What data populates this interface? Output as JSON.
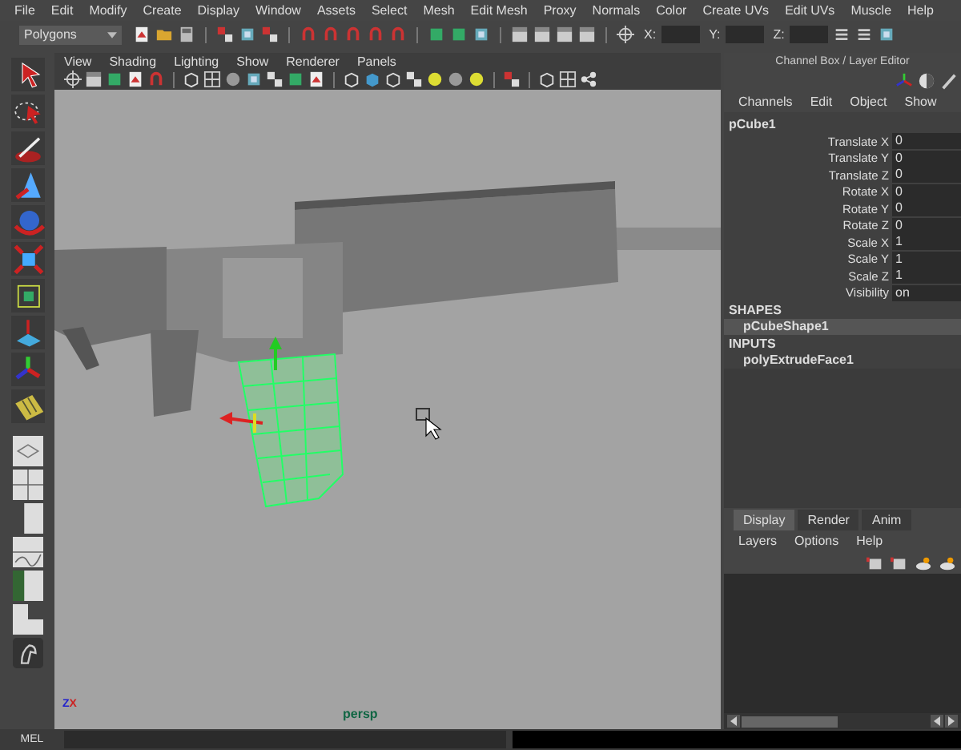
{
  "menu_bar": [
    "File",
    "Edit",
    "Modify",
    "Create",
    "Display",
    "Window",
    "Assets",
    "Select",
    "Mesh",
    "Edit Mesh",
    "Proxy",
    "Normals",
    "Color",
    "Create UVs",
    "Edit UVs",
    "Muscle",
    "Help"
  ],
  "status_line": {
    "menu_set": "Polygons",
    "fields": [
      {
        "label": "X:"
      },
      {
        "label": "Y:"
      },
      {
        "label": "Z:"
      }
    ]
  },
  "viewport": {
    "menu": [
      "View",
      "Shading",
      "Lighting",
      "Show",
      "Renderer",
      "Panels"
    ],
    "camera": "persp",
    "axis_labels": [
      "Z",
      "X"
    ]
  },
  "channel_box": {
    "title": "Channel Box / Layer Editor",
    "menu": [
      "Channels",
      "Edit",
      "Object",
      "Show"
    ],
    "object": "pCube1",
    "attributes": [
      {
        "label": "Translate X",
        "value": "0"
      },
      {
        "label": "Translate Y",
        "value": "0"
      },
      {
        "label": "Translate Z",
        "value": "0"
      },
      {
        "label": "Rotate X",
        "value": "0"
      },
      {
        "label": "Rotate Y",
        "value": "0"
      },
      {
        "label": "Rotate Z",
        "value": "0"
      },
      {
        "label": "Scale X",
        "value": "1"
      },
      {
        "label": "Scale Y",
        "value": "1"
      },
      {
        "label": "Scale Z",
        "value": "1"
      },
      {
        "label": "Visibility",
        "value": "on"
      }
    ],
    "shapes_heading": "SHAPES",
    "shapes": [
      {
        "name": "pCubeShape1",
        "selected": true
      }
    ],
    "inputs_heading": "INPUTS",
    "inputs": [
      {
        "name": "polyExtrudeFace1",
        "selected": false
      }
    ]
  },
  "layer_editor": {
    "tabs": [
      {
        "label": "Display",
        "selected": true
      },
      {
        "label": "Render",
        "selected": false
      },
      {
        "label": "Anim",
        "selected": false
      }
    ],
    "menu": [
      "Layers",
      "Options",
      "Help"
    ]
  },
  "command_line": {
    "label": "MEL"
  }
}
